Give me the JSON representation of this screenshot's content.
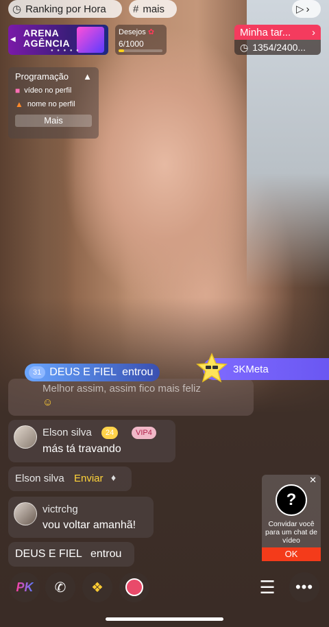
{
  "top": {
    "ranking_label": "Ranking por Hora",
    "tag_label": "mais"
  },
  "arena": {
    "line1": "ARENA",
    "line2": "AGÊNCIA"
  },
  "desejos": {
    "label": "Desejos",
    "value": "6/1000",
    "progress_fraction": 0.006
  },
  "minha": {
    "label": "Minha tar...",
    "count": "1354/2400..."
  },
  "programacao": {
    "title": "Programação",
    "items": [
      "vídeo no perfil",
      "nome no perfil"
    ],
    "more_label": "Mais"
  },
  "meta_banner": {
    "label": "3KMeta"
  },
  "join_banner": {
    "level": "31",
    "user": "DEUS E FIEL",
    "action": "entrou"
  },
  "faded_message": {
    "text": "Melhor assim, assim fico mais feliz"
  },
  "chat": [
    {
      "user": "Elson silva",
      "level": "24",
      "badge": "VIP4",
      "message": "más tá travando"
    },
    {
      "user": "Elson silva",
      "action": "Enviar"
    },
    {
      "user": "victrchg",
      "message": "vou voltar amanhã!"
    },
    {
      "user": "DEUS E FIEL",
      "action": "entrou"
    }
  ],
  "invite": {
    "text": "Convidar você para um chat de vídeo",
    "ok_label": "OK"
  },
  "toolbar": {
    "pk_label": "PK"
  },
  "colors": {
    "accent_red": "#f43b5e",
    "meta_purple": "#7f6bff",
    "ok_orange": "#f43b1a"
  }
}
